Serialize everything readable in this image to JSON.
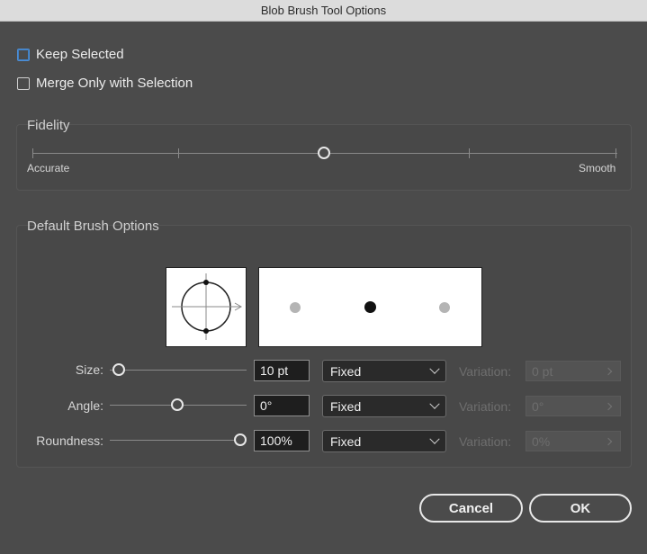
{
  "window": {
    "title": "Blob Brush Tool Options"
  },
  "options": {
    "keep_selected": {
      "label": "Keep Selected",
      "checked": false
    },
    "merge_only": {
      "label": "Merge Only with Selection",
      "checked": false
    }
  },
  "fidelity": {
    "title": "Fidelity",
    "left_label": "Accurate",
    "right_label": "Smooth",
    "value_fraction": 0.5,
    "ticks": 5
  },
  "brush": {
    "title": "Default Brush Options",
    "rows": [
      {
        "label": "Size:",
        "value": "10 pt",
        "mode": "Fixed",
        "variation_label": "Variation:",
        "variation_value": "0 pt",
        "slider_fraction": 0.0
      },
      {
        "label": "Angle:",
        "value": "0°",
        "mode": "Fixed",
        "variation_label": "Variation:",
        "variation_value": "0°",
        "slider_fraction": 0.5
      },
      {
        "label": "Roundness:",
        "value": "100%",
        "mode": "Fixed",
        "variation_label": "Variation:",
        "variation_value": "0%",
        "slider_fraction": 1.0
      }
    ]
  },
  "buttons": {
    "cancel": "Cancel",
    "ok": "OK"
  },
  "colors": {
    "accent_focus": "#4d8fd6",
    "dialog_bg": "#4b4b4b"
  }
}
